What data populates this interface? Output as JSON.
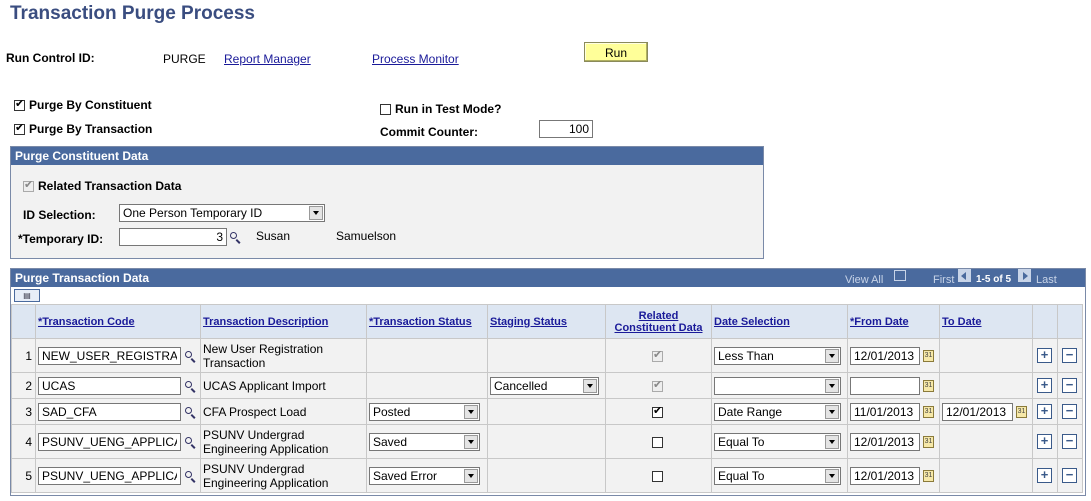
{
  "page": {
    "title": "Transaction Purge Process"
  },
  "run_control": {
    "label": "Run Control ID:",
    "value": "PURGE",
    "report_manager": "Report Manager",
    "process_monitor": "Process Monitor",
    "run_label": "Run"
  },
  "options": {
    "purge_by_constituent": "Purge By Constituent",
    "purge_by_transaction": "Purge By Transaction",
    "run_in_test_mode": "Run in Test Mode?",
    "commit_counter_label": "Commit Counter:",
    "commit_counter_value": "100"
  },
  "constituent_panel": {
    "header": "Purge Constituent Data",
    "related_transaction_data": "Related Transaction Data",
    "id_selection_label": "ID Selection:",
    "id_selection_value": "One Person Temporary ID",
    "temporary_id_label": "*Temporary ID:",
    "temporary_id_value": "3",
    "first_name": "Susan",
    "last_name": "Samuelson"
  },
  "transaction_panel": {
    "header": "Purge Transaction Data",
    "view_all": "View All",
    "first": "First",
    "range": "1-5 of 5",
    "last": "Last",
    "columns": {
      "code": "*Transaction Code",
      "description": "Transaction Description",
      "status": "*Transaction Status",
      "staging": "Staging Status",
      "related_1": "Related",
      "related_2": "Constituent Data",
      "date_selection": "Date Selection",
      "from_date": "*From Date",
      "to_date": "To Date"
    },
    "rows": [
      {
        "num": "1",
        "code": "NEW_USER_REGISTRATI",
        "desc1": "New User Registration",
        "desc2": "Transaction",
        "status": "",
        "staging": "",
        "related": true,
        "date_sel": "Less Than",
        "from": "12/01/2013",
        "to": ""
      },
      {
        "num": "2",
        "code": "UCAS",
        "desc1": "UCAS Applicant Import",
        "desc2": "",
        "status": "",
        "staging": "Cancelled",
        "related": true,
        "date_sel": "",
        "from": "",
        "to": ""
      },
      {
        "num": "3",
        "code": "SAD_CFA",
        "desc1": "CFA Prospect Load",
        "desc2": "",
        "status": "Posted",
        "staging": "",
        "related": true,
        "date_sel": "Date Range",
        "from": "11/01/2013",
        "to": "12/01/2013"
      },
      {
        "num": "4",
        "code": "PSUNV_UENG_APPLICA",
        "desc1": "PSUNV Undergrad",
        "desc2": "Engineering Application",
        "status": "Saved",
        "staging": "",
        "related": false,
        "date_sel": "Equal To",
        "from": "12/01/2013",
        "to": ""
      },
      {
        "num": "5",
        "code": "PSUNV_UENG_APPLICA",
        "desc1": "PSUNV Undergrad",
        "desc2": "Engineering Application",
        "status": "Saved Error",
        "staging": "",
        "related": false,
        "date_sel": "Equal To",
        "from": "12/01/2013",
        "to": ""
      }
    ]
  },
  "icons": {
    "lookup": "magnifier-icon",
    "calendar": "calendar-icon",
    "add": "plus-icon",
    "delete": "minus-icon"
  }
}
